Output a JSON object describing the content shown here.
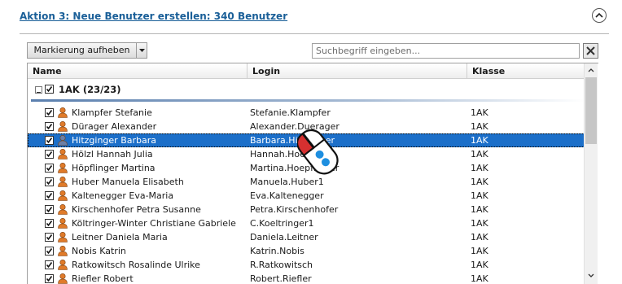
{
  "header": {
    "title": "Aktion 3: Neue Benutzer erstellen: 340 Benutzer"
  },
  "toolbar": {
    "unmark_label": "Markierung aufheben"
  },
  "search": {
    "placeholder": "Suchbegriff eingeben..."
  },
  "columns": {
    "name": "Name",
    "login": "Login",
    "class": "Klasse"
  },
  "group": {
    "label": "1AK  (23/23)"
  },
  "rows": [
    {
      "name": "Klampfer Stefanie",
      "login": "Stefanie.Klampfer",
      "class": "1AK",
      "gender": "f",
      "selected": false
    },
    {
      "name": "Dürager Alexander",
      "login": "Alexander.Duerager",
      "class": "1AK",
      "gender": "f",
      "selected": false
    },
    {
      "name": "Hitzginger Barbara",
      "login": "Barbara.Hitzginger",
      "class": "1AK",
      "gender": "m",
      "selected": true
    },
    {
      "name": "Hölzl Hannah Julia",
      "login": "Hannah.Hoelzl",
      "class": "1AK",
      "gender": "f",
      "selected": false
    },
    {
      "name": "Höpflinger Martina",
      "login": "Martina.Hoepflinger",
      "class": "1AK",
      "gender": "f",
      "selected": false
    },
    {
      "name": "Huber Manuela Elisabeth",
      "login": "Manuela.Huber1",
      "class": "1AK",
      "gender": "f",
      "selected": false
    },
    {
      "name": "Kaltenegger Eva-Maria",
      "login": "Eva.Kaltenegger",
      "class": "1AK",
      "gender": "f",
      "selected": false
    },
    {
      "name": "Kirschenhofer Petra Susanne",
      "login": "Petra.Kirschenhofer",
      "class": "1AK",
      "gender": "f",
      "selected": false
    },
    {
      "name": "Költringer-Winter Christiane Gabriele",
      "login": "C.Koeltringer1",
      "class": "1AK",
      "gender": "f",
      "selected": false
    },
    {
      "name": "Leitner Daniela Maria",
      "login": "Daniela.Leitner",
      "class": "1AK",
      "gender": "f",
      "selected": false
    },
    {
      "name": "Nobis Katrin",
      "login": "Katrin.Nobis",
      "class": "1AK",
      "gender": "f",
      "selected": false
    },
    {
      "name": "Ratkowitsch Rosalinde Ulrike",
      "login": "R.Ratkowitsch",
      "class": "1AK",
      "gender": "f",
      "selected": false
    },
    {
      "name": "Riefler Robert",
      "login": "Robert.Riefler",
      "class": "1AK",
      "gender": "f",
      "selected": false
    }
  ],
  "colors": {
    "link": "#1a5f98",
    "selection": "#1c6fc9",
    "user_female": "#e07b2a",
    "user_male": "#6b7fa6"
  },
  "icons": {
    "collapse": "chevron-up-icon",
    "dropdown": "caret-down-icon",
    "clear": "close-icon",
    "user": "user-icon",
    "cursor": "mouse-click-icon"
  }
}
